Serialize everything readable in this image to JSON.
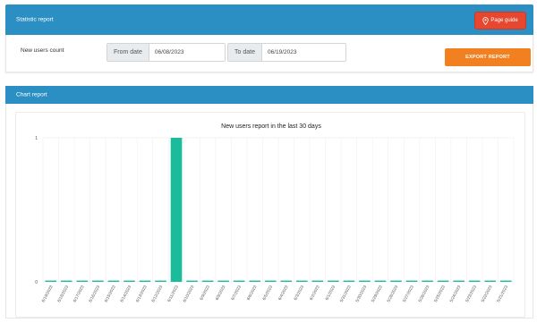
{
  "statistic": {
    "title": "Statistic report",
    "page_guide_label": "Page guide",
    "new_users_label": "New users count",
    "from_date_label": "From date",
    "from_date_value": "06/08/2023",
    "to_date_label": "To date",
    "to_date_value": "06/19/2023",
    "export_label": "EXPORT REPORT"
  },
  "chart_report": {
    "title": "Chart report"
  },
  "colors": {
    "header": "#2b8fc4",
    "guide_button": "#e8472f",
    "export_button": "#f28021",
    "bar": "#1abc9c"
  },
  "chart_data": {
    "type": "bar",
    "title": "New users report in the last 30 days",
    "categories": [
      "6/19/2023",
      "6/18/2023",
      "6/17/2023",
      "6/16/2023",
      "6/15/2023",
      "6/14/2023",
      "6/13/2023",
      "6/12/2023",
      "6/11/2023",
      "6/10/2023",
      "6/9/2023",
      "6/8/2023",
      "6/7/2023",
      "6/6/2023",
      "6/5/2023",
      "6/4/2023",
      "6/3/2023",
      "6/2/2023",
      "6/1/2023",
      "5/31/2023",
      "5/30/2023",
      "5/29/2023",
      "5/28/2023",
      "5/27/2023",
      "5/26/2023",
      "5/25/2023",
      "5/24/2023",
      "5/23/2023",
      "5/22/2023",
      "5/21/2023"
    ],
    "values": [
      0,
      0,
      0,
      0,
      0,
      0,
      0,
      0,
      1,
      0,
      0,
      0,
      0,
      0,
      0,
      0,
      0,
      0,
      0,
      0,
      0,
      0,
      0,
      0,
      0,
      0,
      0,
      0,
      0,
      0
    ],
    "yticks": [
      "0",
      "1"
    ],
    "ylim": [
      0,
      1
    ],
    "grid": true
  }
}
